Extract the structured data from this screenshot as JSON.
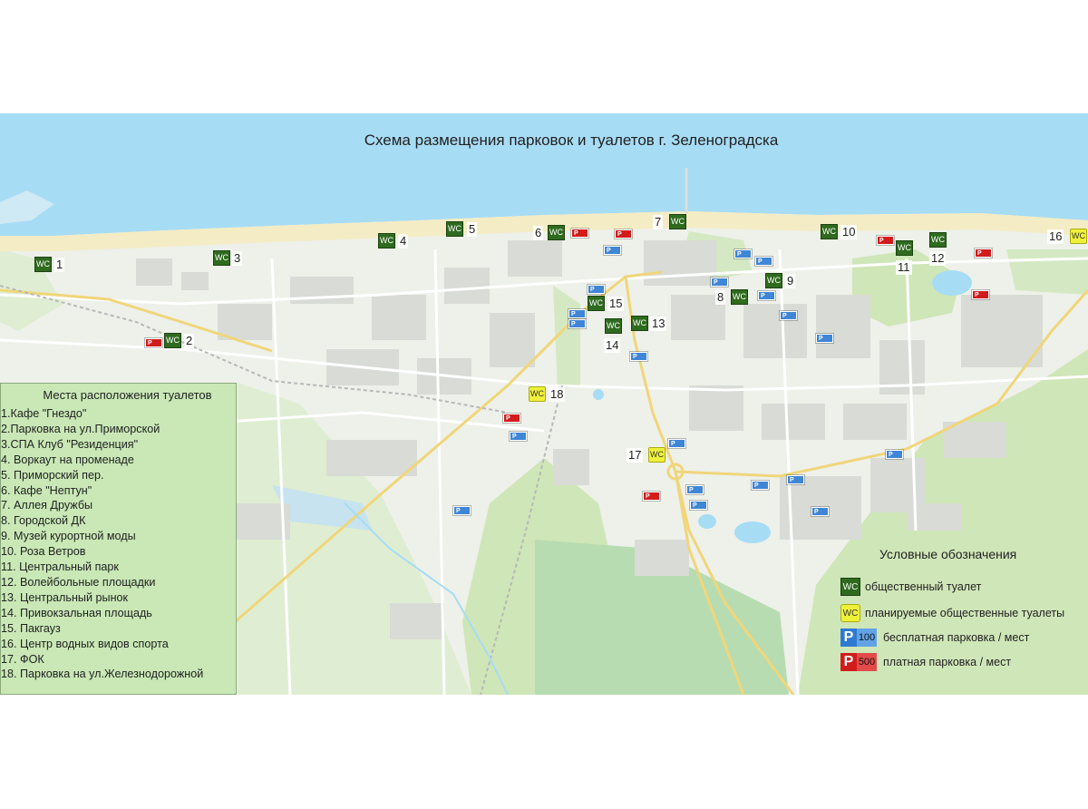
{
  "map": {
    "title": "Схема размещения парковок и туалетов г. Зеленоградска",
    "wc_label": "WC",
    "parking_label": "P",
    "toilet_markers": [
      {
        "num": "1",
        "planned": false
      },
      {
        "num": "2",
        "planned": false
      },
      {
        "num": "3",
        "planned": false
      },
      {
        "num": "4",
        "planned": false
      },
      {
        "num": "5",
        "planned": false
      },
      {
        "num": "6",
        "planned": false
      },
      {
        "num": "7",
        "planned": false
      },
      {
        "num": "8",
        "planned": false
      },
      {
        "num": "9",
        "planned": false
      },
      {
        "num": "10",
        "planned": false
      },
      {
        "num": "11",
        "planned": false
      },
      {
        "num": "12",
        "planned": false
      },
      {
        "num": "13",
        "planned": false
      },
      {
        "num": "14",
        "planned": false
      },
      {
        "num": "15",
        "planned": false
      },
      {
        "num": "16",
        "planned": true
      },
      {
        "num": "17",
        "planned": true
      },
      {
        "num": "18",
        "planned": true
      }
    ]
  },
  "toilets_list": {
    "heading": "Места расположения туалетов",
    "items": [
      "1.Кафе \"Гнездо\"",
      "2.Парковка на ул.Приморской",
      "3.СПА Клуб \"Резиденция\"",
      "4. Воркаут на променаде",
      "5. Приморский пер.",
      "6. Кафе \"Нептун\"",
      "7. Аллея Дружбы",
      "8. Городской ДК",
      "9. Музей курортной моды",
      "10. Роза Ветров",
      "11. Центральный парк",
      "12. Волейбольные площадки",
      "13. Центральный рынок",
      "14. Привокзальная площадь",
      "15. Пакгауз",
      "16. Центр водных видов спорта",
      "17. ФОК",
      "18. Парковка на ул.Железнодорожной"
    ]
  },
  "legend": {
    "heading": "Условные обозначения",
    "wc_symbol": "WC",
    "p_symbol": "P",
    "free_capacity": "100",
    "paid_capacity": "500",
    "public_toilet": "общественный туалет",
    "planned_toilet": "планируемые общественные туалеты",
    "free_parking": "бесплатная парковка / мест",
    "paid_parking": "платная парковка / мест"
  },
  "colors": {
    "sea": "#a7dcf5",
    "beach": "#f4ecc4",
    "forest": "#cfe6b8",
    "toilet_green": "#2f6b1f",
    "toilet_planned": "#eef03a",
    "parking_free": "#3f86d6",
    "parking_paid": "#d21b1b"
  }
}
